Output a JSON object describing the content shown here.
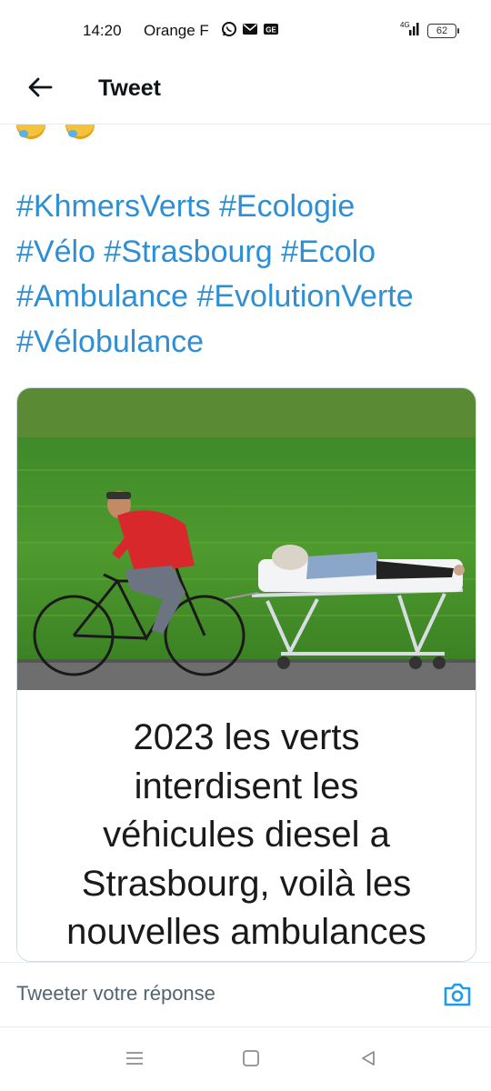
{
  "status_bar": {
    "time": "14:20",
    "carrier": "Orange F",
    "network": "4G",
    "battery": "62"
  },
  "header": {
    "title": "Tweet",
    "back_icon": "arrow-left-icon"
  },
  "tweet": {
    "hashtags": [
      [
        "#KhmersVerts",
        "#Ecologie"
      ],
      [
        "#Vélo",
        "#Strasbourg",
        "#Ecolo"
      ],
      [
        "#Ambulance",
        "#EvolutionVerte"
      ],
      [
        "#Vélobulance"
      ]
    ],
    "media": {
      "caption": "2023 les verts\ninterdisent les\nvéhicules diesel a\nStrasbourg, voilà les\nnouvelles  ambulances"
    }
  },
  "reply": {
    "placeholder": "Tweeter votre réponse"
  },
  "colors": {
    "link": "#1d9bf0",
    "accent": "#1d9bf0",
    "text": "#0f1419",
    "muted": "#536471",
    "border": "#e6ecf0"
  },
  "nav_bar": {
    "icons": [
      "menu-icon",
      "home-square-icon",
      "back-triangle-icon"
    ]
  }
}
